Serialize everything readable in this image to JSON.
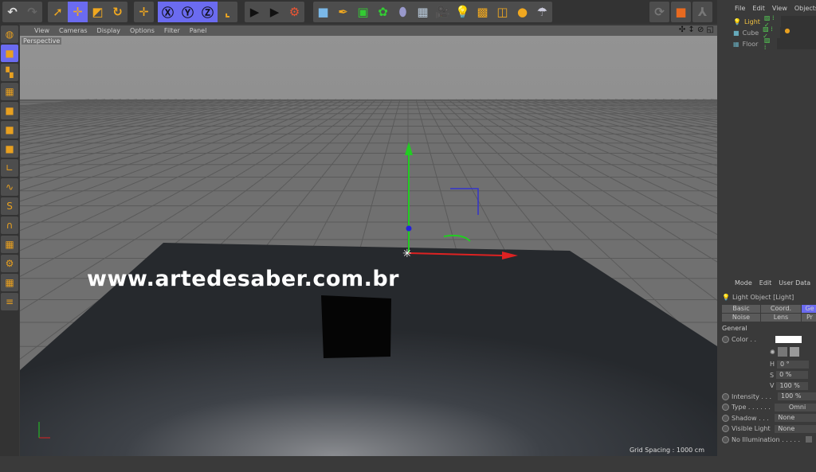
{
  "toolbar": {
    "groups": [
      [
        "undo-icon",
        "redo-icon"
      ],
      [
        "live-selection-icon",
        "move-icon",
        "scale-icon",
        "rotate-icon"
      ],
      [
        "last-tool-icon"
      ],
      [
        "x-axis-icon",
        "y-axis-icon",
        "z-axis-icon",
        "coordinate-system-icon"
      ],
      [
        "render-view-icon",
        "render-picture-viewer-icon",
        "render-settings-icon"
      ],
      [
        "cube-icon",
        "pen-icon",
        "subdivision-icon",
        "array-icon",
        "deformer-icon",
        "floor-icon",
        "camera-icon",
        "light-icon",
        "scene-icon",
        "sketch-icon",
        "xyz-icon",
        "parachute-icon"
      ]
    ],
    "axis_labels": [
      "X",
      "Y",
      "Z"
    ]
  },
  "viewport": {
    "menu": [
      "View",
      "Cameras",
      "Display",
      "Options",
      "Filter",
      "Panel"
    ],
    "camera": "Perspective",
    "watermark": "www.artedesaber.com.br",
    "grid_spacing": "Grid Spacing : 1000 cm",
    "nav_icons": "✣ ↕ ⊘ ◱"
  },
  "objects": {
    "menu": [
      "File",
      "Edit",
      "View",
      "Objects"
    ],
    "items": [
      {
        "name": "Light",
        "color": "#f0c040",
        "icon": "💡"
      },
      {
        "name": "Cube",
        "color": "#aaaaaa",
        "icon": "■"
      },
      {
        "name": "Floor",
        "color": "#aaaaaa",
        "icon": "▦"
      }
    ]
  },
  "attributes": {
    "menu": [
      "Mode",
      "Edit",
      "User Data"
    ],
    "title": "Light Object [Light]",
    "tabs": [
      "Basic",
      "Coord.",
      "Ge",
      "Noise",
      "Lens",
      "Pr"
    ],
    "section": "General",
    "color_label": "Color . .",
    "color_value": "#ffffff",
    "h_label": "H",
    "h": "0 °",
    "s_label": "S",
    "s": "0 %",
    "v_label": "V",
    "v": "100 %",
    "intensity_label": "Intensity . . .",
    "intensity": "100 %",
    "type_label": "Type . . . . . .",
    "type": "Omni",
    "shadow_label": "Shadow . . .",
    "shadow": "None",
    "visible_label": "Visible Light",
    "visible": "None",
    "noillum_label": "No Illumination . . . . ."
  }
}
